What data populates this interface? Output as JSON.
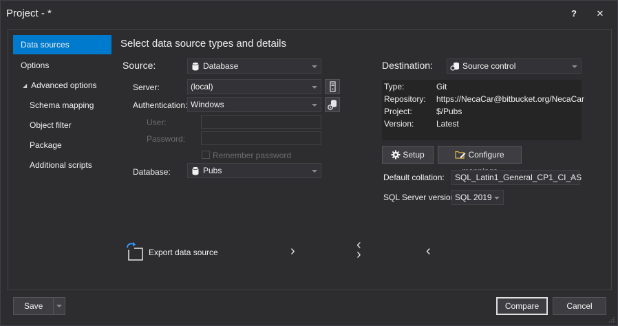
{
  "window": {
    "title": "Project  - *",
    "help_label": "?",
    "close_label": "✕"
  },
  "nav": [
    {
      "label": "Data sources",
      "active": true
    },
    {
      "label": "Options"
    },
    {
      "label": "Advanced options",
      "expander": "◢"
    },
    {
      "label": "Schema mapping"
    },
    {
      "label": "Object filter"
    },
    {
      "label": "Package"
    },
    {
      "label": "Additional scripts"
    }
  ],
  "main": {
    "heading": "Select data source types and details"
  },
  "source": {
    "label": "Source:",
    "type": "Database",
    "server_label": "Server:",
    "server": "(local)",
    "auth_label": "Authentication:",
    "auth": "Windows",
    "user_label": "User:",
    "user": "",
    "password_label": "Password:",
    "password": "",
    "remember_label": "Remember password",
    "database_label": "Database:",
    "database": "Pubs"
  },
  "destination": {
    "label": "Destination:",
    "type": "Source control",
    "info": [
      {
        "key": "Type:",
        "value": "Git"
      },
      {
        "key": "Repository:",
        "value": "https://NecaCar@bitbucket.org/NecaCar"
      },
      {
        "key": "Project:",
        "value": "$/Pubs"
      },
      {
        "key": "Version:",
        "value": "Latest"
      }
    ],
    "setup_label": "Setup",
    "configure_label": "Configure mappings",
    "collation_label": "Default collation:",
    "collation": "SQL_Latin1_General_CP1_CI_AS",
    "version_label": "SQL Server version:",
    "version": "SQL 2019"
  },
  "actions": {
    "export_label": "Export data source",
    "copy_right": "›",
    "swap_top": "‹",
    "swap_bottom": "›",
    "copy_left": "‹"
  },
  "footer": {
    "save_label": "Save",
    "compare_label": "Compare",
    "cancel_label": "Cancel"
  },
  "colors": {
    "accent": "#007acc",
    "background": "#2d2d30",
    "panel": "#252526"
  }
}
